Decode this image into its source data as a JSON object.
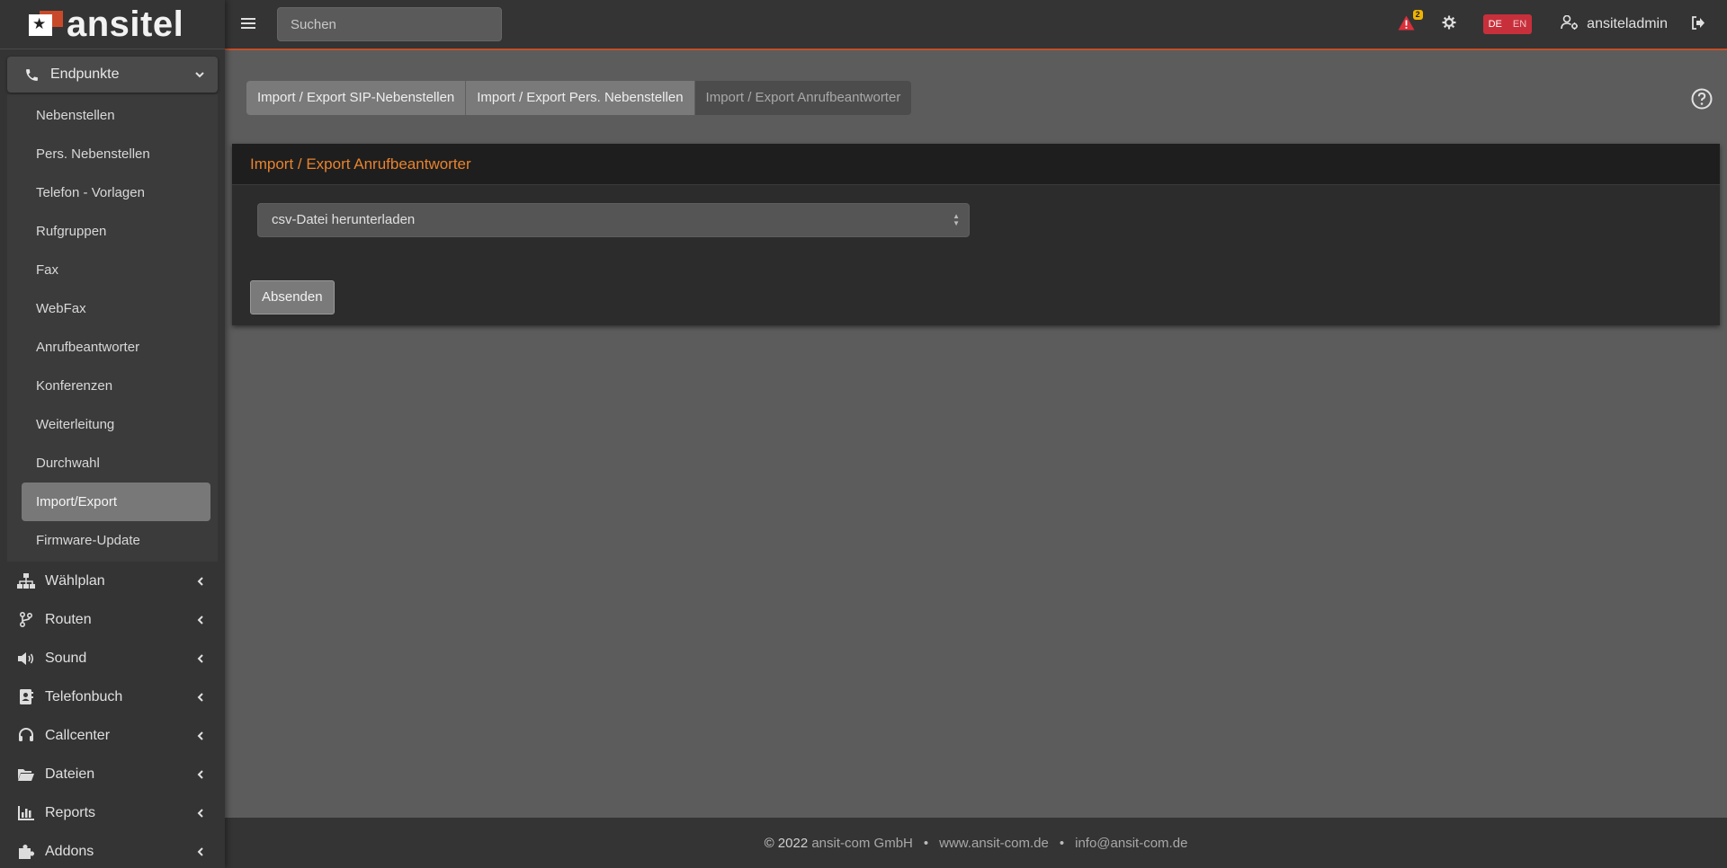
{
  "brand": {
    "name": "ansitel"
  },
  "topbar": {
    "search_placeholder": "Suchen",
    "alert_count": "2",
    "lang_de": "DE",
    "lang_en": "EN",
    "username": "ansiteladmin"
  },
  "sidebar": {
    "endpoints": {
      "label": "Endpunkte",
      "children": [
        "Nebenstellen",
        "Pers. Nebenstellen",
        "Telefon - Vorlagen",
        "Rufgruppen",
        "Fax",
        "WebFax",
        "Anrufbeantworter",
        "Konferenzen",
        "Weiterleitung",
        "Durchwahl",
        "Import/Export",
        "Firmware-Update"
      ]
    },
    "groups": [
      "Wählplan",
      "Routen",
      "Sound",
      "Telefonbuch",
      "Callcenter",
      "Dateien",
      "Reports",
      "Addons"
    ]
  },
  "tabs": [
    "Import / Export SIP-Nebenstellen",
    "Import / Export Pers. Nebenstellen",
    "Import / Export Anrufbeantworter"
  ],
  "card": {
    "title": "Import / Export Anrufbeantworter",
    "select_value": "csv-Datei herunterladen",
    "submit_label": "Absenden"
  },
  "footer": {
    "copyright": "© 2022",
    "company": "ansit-com GmbH",
    "website": "www.ansit-com.de",
    "email": "info@ansit-com.de",
    "separator": "•"
  },
  "colors": {
    "accent": "#e8832e",
    "topbar_border": "#c4502a",
    "lang_badge": "#c7303b",
    "alert": "#d9303b",
    "badge": "#f0b400"
  }
}
